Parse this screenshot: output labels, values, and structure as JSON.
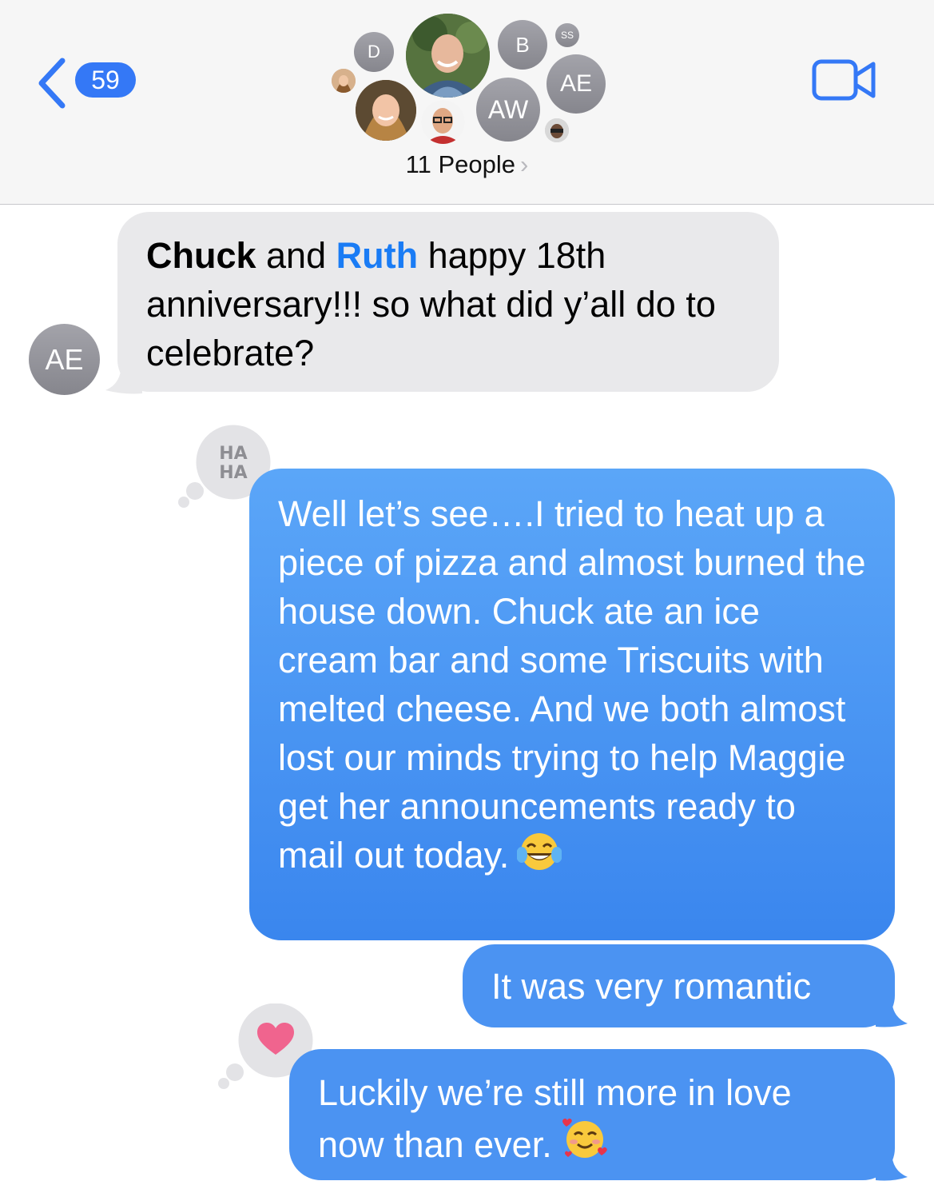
{
  "header": {
    "unread_count": "59",
    "people_label": "11 People",
    "avatars": [
      {
        "name": "avatar-d",
        "initials": "D"
      },
      {
        "name": "avatar-b",
        "initials": "B"
      },
      {
        "name": "avatar-ss",
        "initials": "SS"
      },
      {
        "name": "avatar-ae",
        "initials": "AE"
      },
      {
        "name": "avatar-aw",
        "initials": "AW"
      }
    ]
  },
  "messages": {
    "m1": {
      "sender_initials": "AE",
      "mention1": "Chuck",
      "t1": " and ",
      "mention2": "Ruth",
      "t2": " happy 18th anniversary!!! so what did y’all do to celebrate?"
    },
    "m2": {
      "text": "Well let’s see….I tried to heat up a piece of pizza and almost burned the house down. Chuck ate an ice cream bar and some Triscuits with melted cheese. And we both almost lost our minds trying to help Maggie get her announcements ready to mail out today.",
      "reaction": "HA HA",
      "emoji": "tears-of-joy-emoji"
    },
    "m3": {
      "text": "It was very romantic"
    },
    "m4": {
      "text": "Luckily we’re still more in love now than ever.",
      "reaction": "heart",
      "emoji": "smiling-face-with-hearts-emoji"
    }
  },
  "colors": {
    "accent": "#3478f6",
    "outgoing_bubble": "#4b95f3",
    "incoming_bubble": "#e9e9eb",
    "heart": "#f0648e"
  }
}
